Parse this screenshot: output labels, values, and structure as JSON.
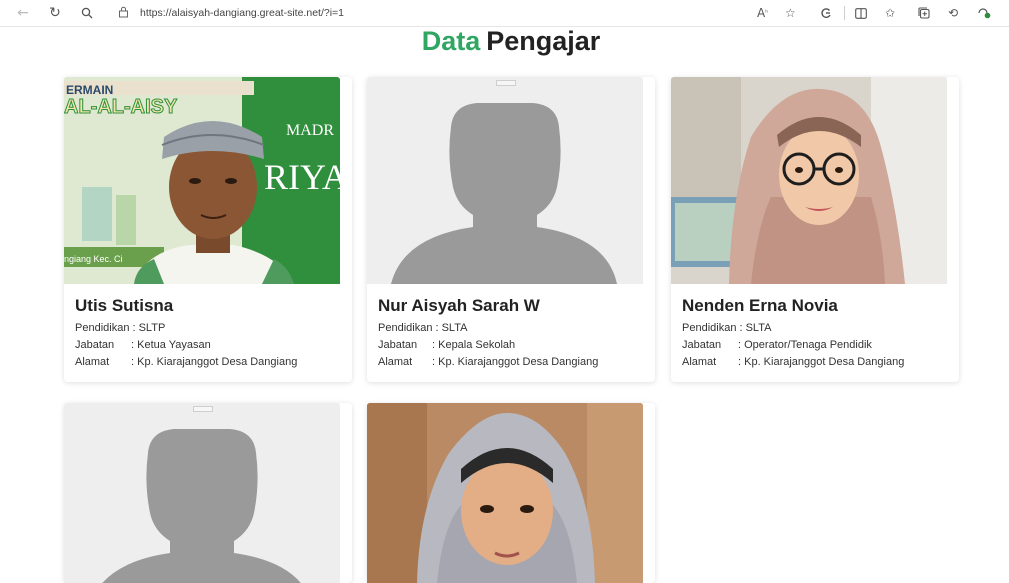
{
  "browser": {
    "url": "https://alaisyah-dangiang.great-site.net/?i=1",
    "icons": [
      "back-icon",
      "refresh-icon",
      "search-icon",
      "lock-icon",
      "read-aloud-icon",
      "favorite-icon",
      "extension-icon",
      "split-screen-icon",
      "favorites-bar-icon",
      "collections-icon",
      "history-icon",
      "browser-essentials-icon"
    ]
  },
  "page": {
    "title_accent": "Data",
    "title_rest": "Pengajar"
  },
  "teachers": [
    {
      "name": "Utis Sutisna",
      "pendidikan": "Pendidikan : SLTP",
      "jabatan_label": "Jabatan",
      "jabatan": ": Ketua Yayasan",
      "alamat_label": "Alamat",
      "alamat": ": Kp. Kiarajanggot Desa Dangiang",
      "photo": "man-with-cap",
      "banner_text_1": "ERMAIN",
      "banner_text_2": "AL-AL-AISY",
      "banner_text_3": "MADR",
      "banner_text_4": "RIYA",
      "banner_text_5": "ngiang Kec. Ci"
    },
    {
      "name": "Nur Aisyah Sarah W",
      "pendidikan": "Pendidikan : SLTA",
      "jabatan_label": "Jabatan",
      "jabatan": ": Kepala Sekolah",
      "alamat_label": "Alamat",
      "alamat": ": Kp. Kiarajanggot Desa Dangiang",
      "photo": "placeholder-silhouette"
    },
    {
      "name": "Nenden Erna Novia",
      "pendidikan": "Pendidikan : SLTA",
      "jabatan_label": "Jabatan",
      "jabatan": ": Operator/Tenaga Pendidik",
      "alamat_label": "Alamat",
      "alamat": ": Kp. Kiarajanggot Desa Dangiang",
      "photo": "woman-hijab-glasses"
    },
    {
      "photo": "placeholder-silhouette"
    },
    {
      "photo": "woman-grey-hijab"
    }
  ],
  "colors": {
    "accent": "#2fa662",
    "placeholder_bg": "#eeeeee",
    "silhouette": "#9a9a9a"
  }
}
